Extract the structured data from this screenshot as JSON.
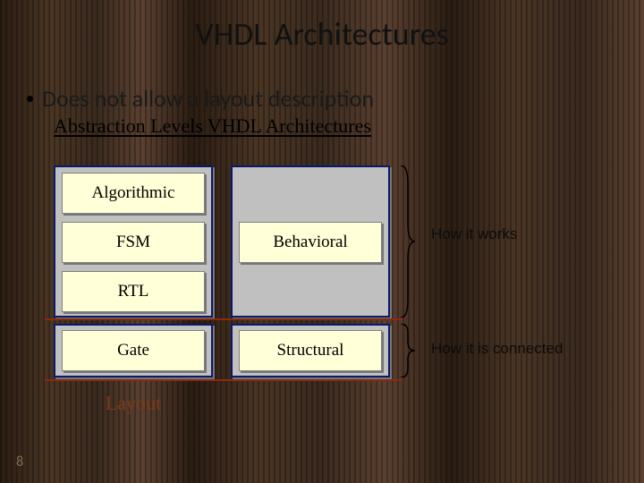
{
  "title": "VHDL Architectures",
  "bullet": "Does not allow a layout description",
  "subtitle": "Abstraction Levels VHDL Architectures",
  "levels": {
    "algorithmic": "Algorithmic",
    "fsm": "FSM",
    "rtl": "RTL",
    "gate": "Gate",
    "layout": "Layout"
  },
  "arch": {
    "behavioral": "Behavioral",
    "structural": "Structural"
  },
  "annotations": {
    "how_works": "How it works",
    "how_connected": "How it is connected"
  },
  "page_number": "8"
}
